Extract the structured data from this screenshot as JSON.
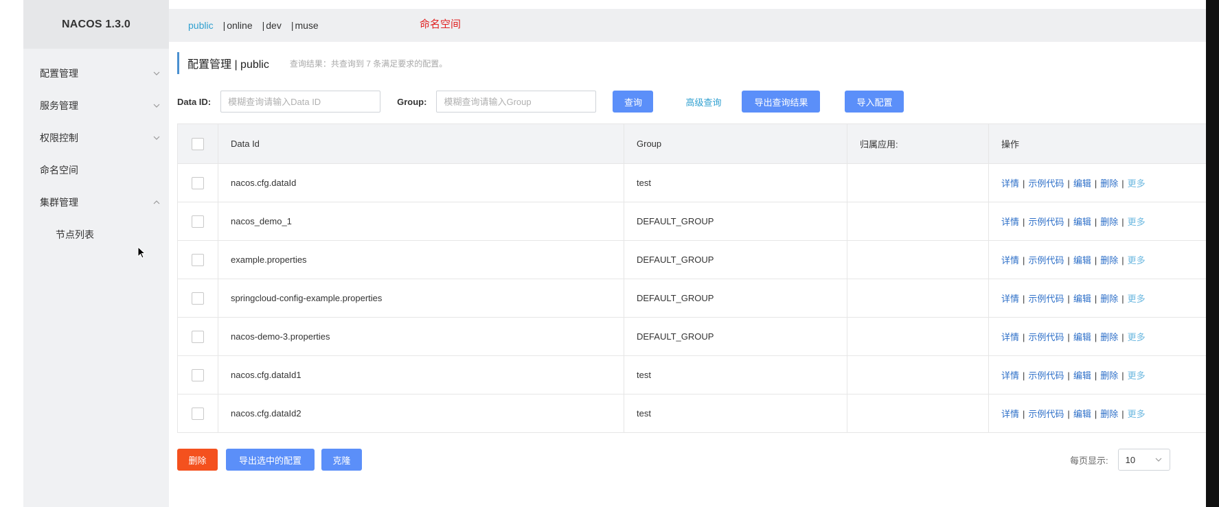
{
  "app": {
    "title": "NACOS 1.3.0"
  },
  "sidebar": {
    "items": [
      {
        "label": "配置管理",
        "expandable": true,
        "expanded": false
      },
      {
        "label": "服务管理",
        "expandable": true,
        "expanded": false
      },
      {
        "label": "权限控制",
        "expandable": true,
        "expanded": false
      },
      {
        "label": "命名空间",
        "expandable": false
      },
      {
        "label": "集群管理",
        "expandable": true,
        "expanded": true
      }
    ],
    "subitems": [
      {
        "label": "节点列表"
      }
    ]
  },
  "namespace": {
    "tabs": [
      {
        "label": "public",
        "active": true
      },
      {
        "label": "online",
        "active": false
      },
      {
        "label": "dev",
        "active": false
      },
      {
        "label": "muse",
        "active": false
      }
    ],
    "separator": "|",
    "annotation": "命名空间"
  },
  "header": {
    "title": "配置管理 | public",
    "result": "查询结果：共查询到 7 条满足要求的配置。"
  },
  "search": {
    "dataid_label": "Data ID:",
    "dataid_placeholder": "模糊查询请输入Data ID",
    "group_label": "Group:",
    "group_placeholder": "模糊查询请输入Group",
    "query_button": "查询",
    "advanced_link": "高级查询",
    "export_button": "导出查询结果",
    "import_button": "导入配置"
  },
  "table": {
    "columns": [
      "Data Id",
      "Group",
      "归属应用:",
      "操作"
    ],
    "rows": [
      {
        "data_id": "nacos.cfg.dataId",
        "group": "test",
        "app": ""
      },
      {
        "data_id": "nacos_demo_1",
        "group": "DEFAULT_GROUP",
        "app": ""
      },
      {
        "data_id": "example.properties",
        "group": "DEFAULT_GROUP",
        "app": ""
      },
      {
        "data_id": "springcloud-config-example.properties",
        "group": "DEFAULT_GROUP",
        "app": ""
      },
      {
        "data_id": "nacos-demo-3.properties",
        "group": "DEFAULT_GROUP",
        "app": ""
      },
      {
        "data_id": "nacos.cfg.dataId1",
        "group": "test",
        "app": ""
      },
      {
        "data_id": "nacos.cfg.dataId2",
        "group": "test",
        "app": ""
      }
    ],
    "ops": [
      "详情",
      "示例代码",
      "编辑",
      "删除",
      "更多"
    ],
    "ops_separator": "|"
  },
  "footer": {
    "delete_button": "删除",
    "export_selected_button": "导出选中的配置",
    "clone_button": "克隆",
    "page_size_label": "每页显示:",
    "page_size_value": "10"
  },
  "colors": {
    "accent": "#5b8ff9",
    "link": "#2d6fc8",
    "active_tab": "#30a0d0",
    "danger": "#f4511e",
    "annotation": "#e02020"
  }
}
